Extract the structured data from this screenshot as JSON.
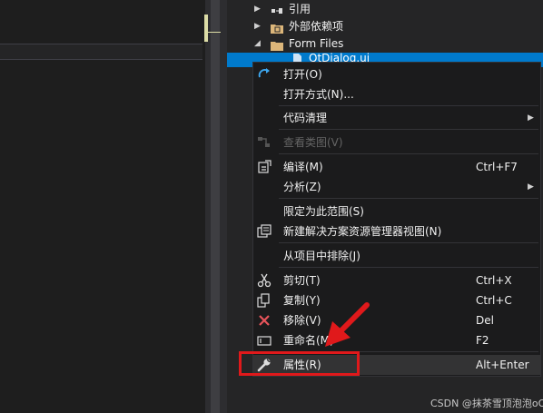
{
  "explorer": {
    "items": [
      {
        "label": "引用",
        "arrow": "▶",
        "icon": "references-icon"
      },
      {
        "label": "外部依赖项",
        "arrow": "▶",
        "icon": "external-dependencies-icon"
      },
      {
        "label": "Form Files",
        "arrow": "◢",
        "icon": "folder-icon"
      }
    ],
    "selected_label": "QtDialog.ui"
  },
  "context_menu": {
    "open": "打开(O)",
    "open_with": "打开方式(N)...",
    "code_cleanup": "代码清理",
    "view_class_diagram": "查看类图(V)",
    "compile": "编译(M)",
    "compile_shortcut": "Ctrl+F7",
    "analyze": "分析(Z)",
    "scope_to_this": "限定为此范围(S)",
    "new_solution_explorer_view": "新建解决方案资源管理器视图(N)",
    "exclude_from_project": "从项目中排除(J)",
    "cut": "剪切(T)",
    "cut_shortcut": "Ctrl+X",
    "copy": "复制(Y)",
    "copy_shortcut": "Ctrl+C",
    "remove": "移除(V)",
    "remove_shortcut": "Del",
    "rename": "重命名(M)",
    "rename_shortcut": "F2",
    "properties": "属性(R)",
    "properties_shortcut": "Alt+Enter",
    "submenu_arrow": "▶"
  },
  "watermark": "CSDN @抹茶雪顶泡泡oO",
  "colors": {
    "selection": "#007acc",
    "menu_background": "#1b1b1c",
    "highlight_box": "#e0191b"
  }
}
